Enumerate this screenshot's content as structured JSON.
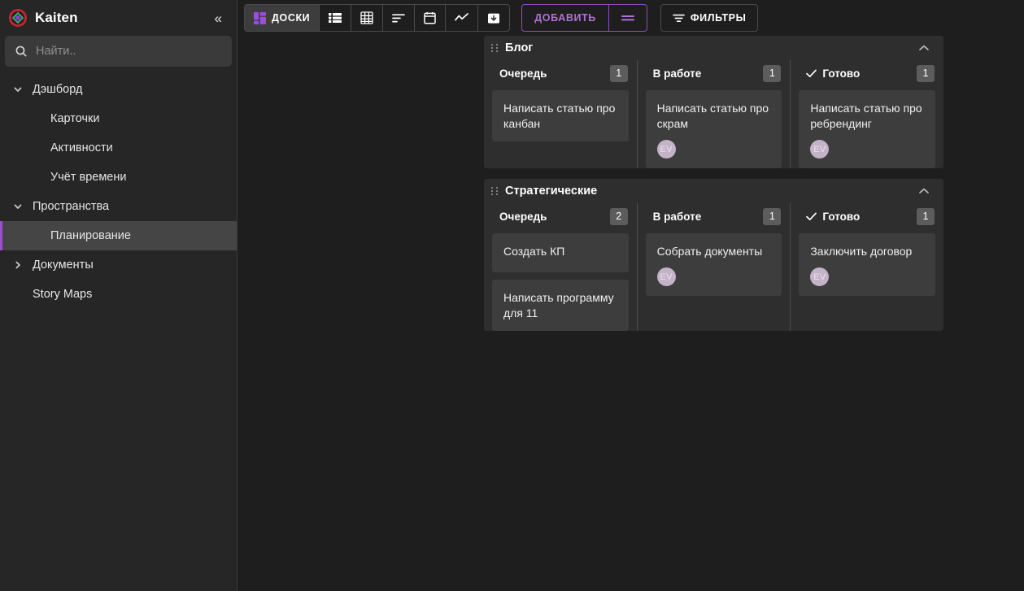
{
  "sidebar": {
    "brand": "Kaiten",
    "collapse_icon": "chevron-double-left-icon",
    "search": {
      "placeholder": "Найти..",
      "value": "",
      "icon": "search-icon"
    },
    "items": [
      {
        "label": "Дэшборд",
        "level": 0,
        "arrow": "chevron-down",
        "selected": false
      },
      {
        "label": "Карточки",
        "level": 1,
        "arrow": "",
        "selected": false
      },
      {
        "label": "Активности",
        "level": 1,
        "arrow": "",
        "selected": false
      },
      {
        "label": "Учёт времени",
        "level": 1,
        "arrow": "",
        "selected": false
      },
      {
        "label": "Пространства",
        "level": 0,
        "arrow": "chevron-down",
        "selected": false
      },
      {
        "label": "Планирование",
        "level": 1,
        "arrow": "",
        "selected": true
      },
      {
        "label": "Документы",
        "level": 0,
        "arrow": "chevron-right",
        "selected": false
      },
      {
        "label": "Story Maps",
        "level": 0,
        "arrow": "none",
        "selected": false
      }
    ]
  },
  "toolbar": {
    "views": [
      {
        "label": "ДОСКИ",
        "icon": "boards-icon",
        "active": true
      },
      {
        "label": "",
        "icon": "list-icon",
        "active": false
      },
      {
        "label": "",
        "icon": "grid-icon",
        "active": false
      },
      {
        "label": "",
        "icon": "sort-icon",
        "active": false
      },
      {
        "label": "",
        "icon": "calendar-icon",
        "active": false
      },
      {
        "label": "",
        "icon": "chart-icon",
        "active": false
      },
      {
        "label": "",
        "icon": "archive-icon",
        "active": false
      }
    ],
    "add_label": "ДОБАВИТЬ",
    "add_menu_icon": "equals-menu-icon",
    "filters_label": "ФИЛЬТРЫ",
    "filters_icon": "filter-icon",
    "accent_color": "#b071d8"
  },
  "boards": [
    {
      "title": "Блог",
      "drag_handle_icon": "drag-dots-icon",
      "collapse_icon": "chevron-up-icon",
      "body_height": 275,
      "columns": [
        {
          "name": "Очередь",
          "count": "1",
          "done": false,
          "cards": [
            {
              "title": "Написать статью про канбан",
              "avatar": ""
            }
          ]
        },
        {
          "name": "В работе",
          "count": "1",
          "done": false,
          "cards": [
            {
              "title": "Написать статью про скрам",
              "avatar": "EV"
            }
          ]
        },
        {
          "name": "Готово",
          "count": "1",
          "done": true,
          "cards": [
            {
              "title": "Написать статью про ребрендинг",
              "avatar": "EV"
            }
          ]
        }
      ]
    },
    {
      "title": "Стратегические",
      "drag_handle_icon": "drag-dots-icon",
      "collapse_icon": "chevron-up-icon",
      "body_height": 266,
      "columns": [
        {
          "name": "Очередь",
          "count": "2",
          "done": false,
          "cards": [
            {
              "title": "Создать КП",
              "avatar": ""
            },
            {
              "title": "Написать программу для 11",
              "avatar": ""
            }
          ]
        },
        {
          "name": "В работе",
          "count": "1",
          "done": false,
          "cards": [
            {
              "title": "Собрать документы",
              "avatar": "EV"
            }
          ]
        },
        {
          "name": "Готово",
          "count": "1",
          "done": true,
          "cards": [
            {
              "title": "Заключить договор",
              "avatar": "EV"
            }
          ]
        }
      ]
    }
  ]
}
